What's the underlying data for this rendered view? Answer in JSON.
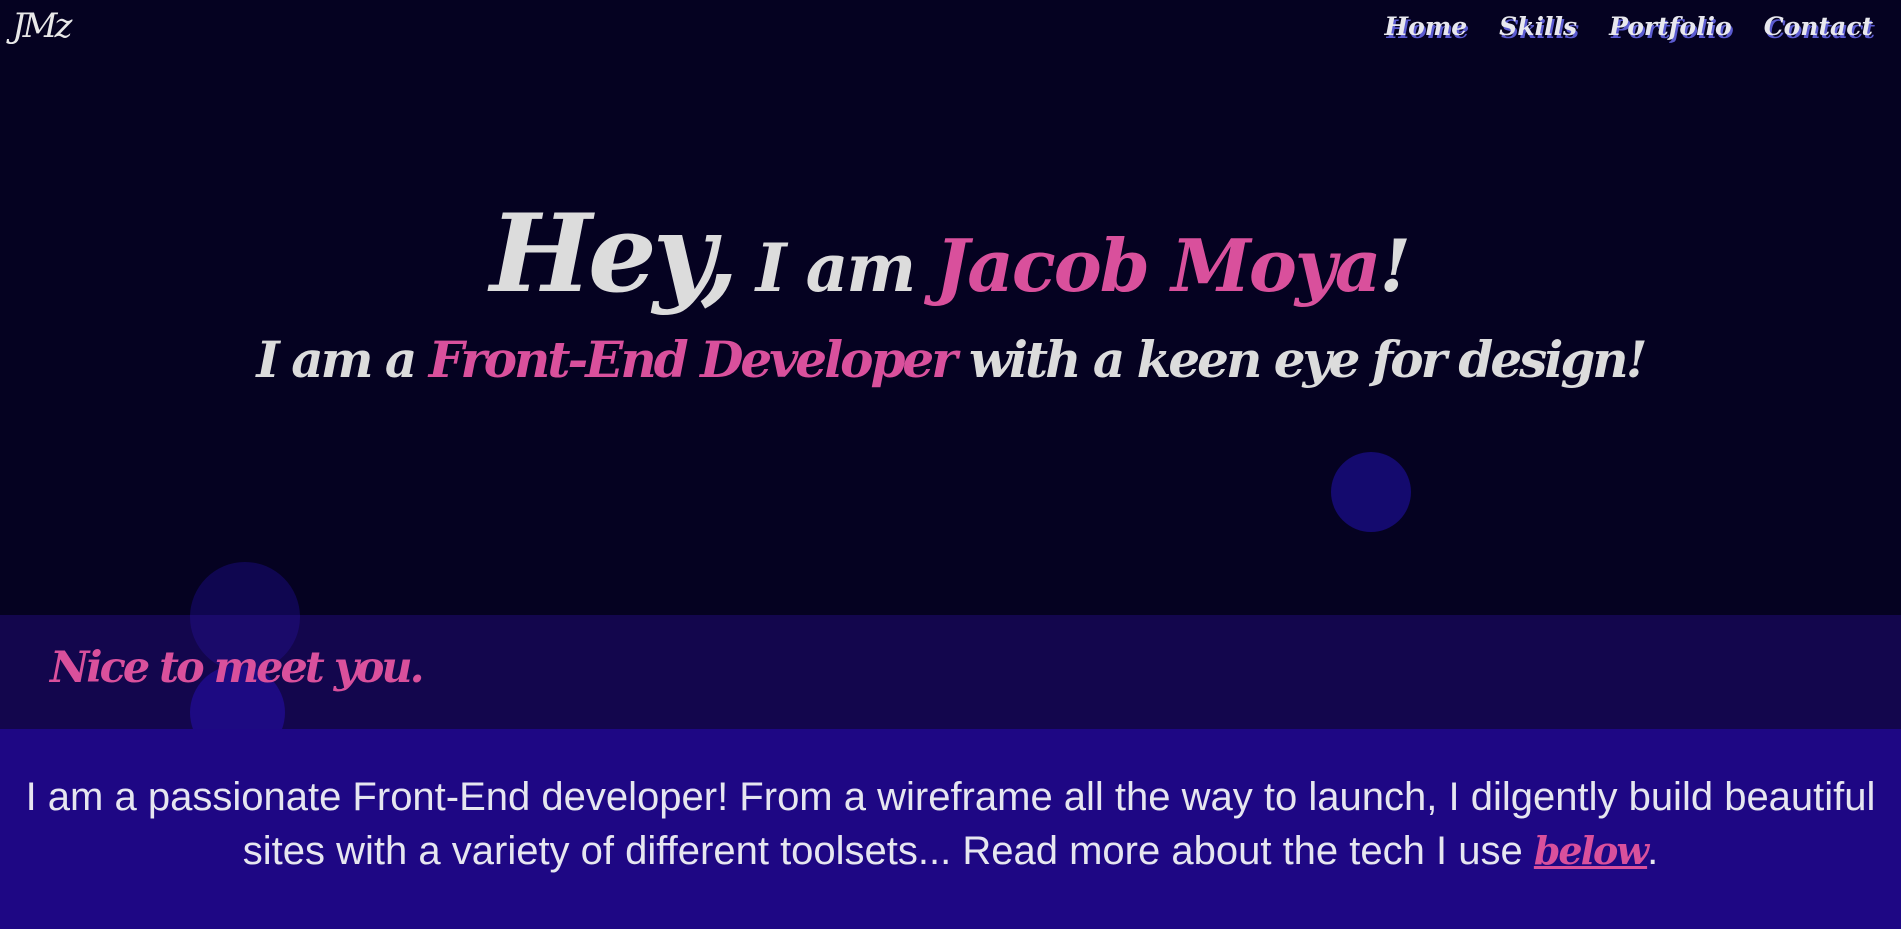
{
  "logo": {
    "text": "JMz"
  },
  "nav": {
    "items": [
      {
        "label": "Home"
      },
      {
        "label": "Skills"
      },
      {
        "label": "Portfolio"
      },
      {
        "label": "Contact"
      }
    ]
  },
  "hero": {
    "hey": "Hey,",
    "iam": " I am ",
    "name": "Jacob Moya",
    "excl": "!",
    "line2_prefix": "I am a ",
    "role": "Front-End Developer",
    "line2_suffix": " with a keen eye for design!"
  },
  "band": {
    "greeting": "Nice to meet you."
  },
  "about": {
    "text": "I am a passionate Front-End developer! From a wireframe all the way to launch, I dilgently build beautiful sites with a variety of different toolsets... Read more about the tech I use ",
    "link": "below",
    "end": "."
  },
  "colors": {
    "accent": "#d9509c",
    "hero_bg": "#050221",
    "band_bg": "#13064d",
    "about_bg": "#1e0784",
    "nav_shadow": "#5b5bd0"
  }
}
